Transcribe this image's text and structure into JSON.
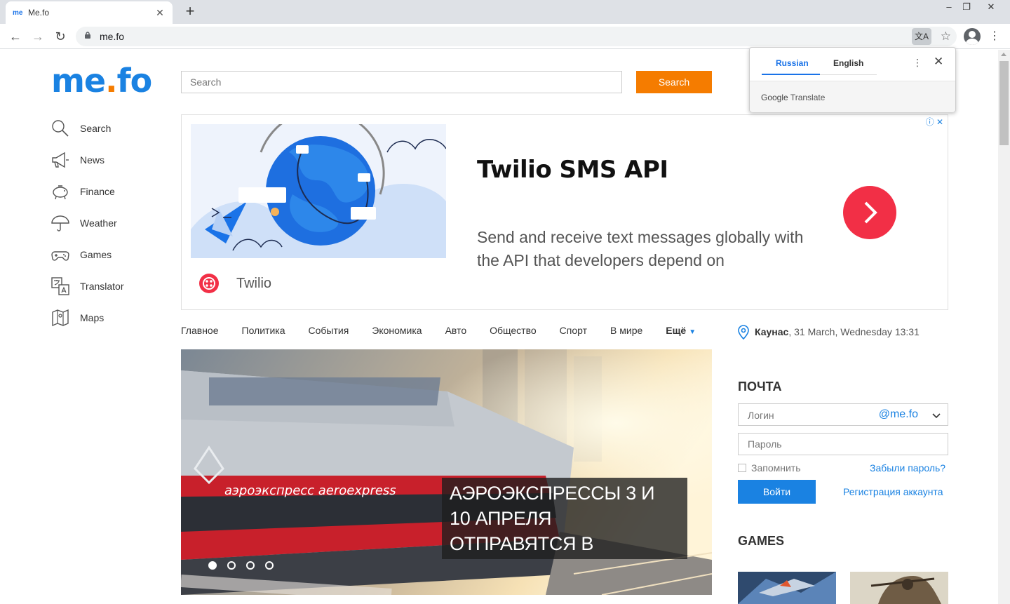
{
  "browser": {
    "tab_title": "Me.fo",
    "tab_favicon": "me",
    "url": "me.fo",
    "window_controls": [
      "–",
      "❐",
      "✕"
    ]
  },
  "site": {
    "logo": {
      "left": "me",
      "dot": ".",
      "right": "fo"
    },
    "colors": {
      "brand_blue": "#1a82e2",
      "accent_orange": "#f57c00",
      "ad_red": "#f22f46"
    }
  },
  "sidebar": {
    "items": [
      {
        "label": "Search",
        "icon": "search-icon"
      },
      {
        "label": "News",
        "icon": "megaphone-icon"
      },
      {
        "label": "Finance",
        "icon": "piggy-bank-icon"
      },
      {
        "label": "Weather",
        "icon": "umbrella-icon"
      },
      {
        "label": "Games",
        "icon": "gamepad-icon"
      },
      {
        "label": "Translator",
        "icon": "translate-icon"
      },
      {
        "label": "Maps",
        "icon": "map-icon"
      }
    ]
  },
  "search": {
    "placeholder": "Search",
    "button": "Search"
  },
  "ad": {
    "title": "Twilio SMS API",
    "description": "Send and receive text messages globally with the API that developers depend on",
    "brand": "Twilio"
  },
  "categories": [
    "Главное",
    "Политика",
    "События",
    "Экономика",
    "Авто",
    "Общество",
    "Спорт",
    "В мире"
  ],
  "categories_more": "Ещё",
  "location": {
    "city": "Каунас",
    "datetime": ", 31 March, Wednesday 13:31"
  },
  "hero": {
    "caption": "АЭРОЭКСПРЕССЫ 3 И 10 АПРЕЛЯ ОТПРАВЯТСЯ В ШЕРЕМЕТЬЕВО ТОЛЬКО С",
    "train_text": "аэроэкспресс aeroexpress",
    "slides": 4,
    "active_slide": 1
  },
  "mail": {
    "title": "ПОЧТА",
    "login_placeholder": "Логин",
    "domain": "@me.fo",
    "password_placeholder": "Пароль",
    "remember": "Запомнить",
    "forgot": "Забыли пароль?",
    "login_button": "Войти",
    "register": "Регистрация аккаунта"
  },
  "games": {
    "title": "GAMES"
  },
  "translate_popup": {
    "tabs": [
      "Russian",
      "English"
    ],
    "active_tab": "Russian",
    "brand": "Google",
    "brand_suffix": "Translate"
  }
}
